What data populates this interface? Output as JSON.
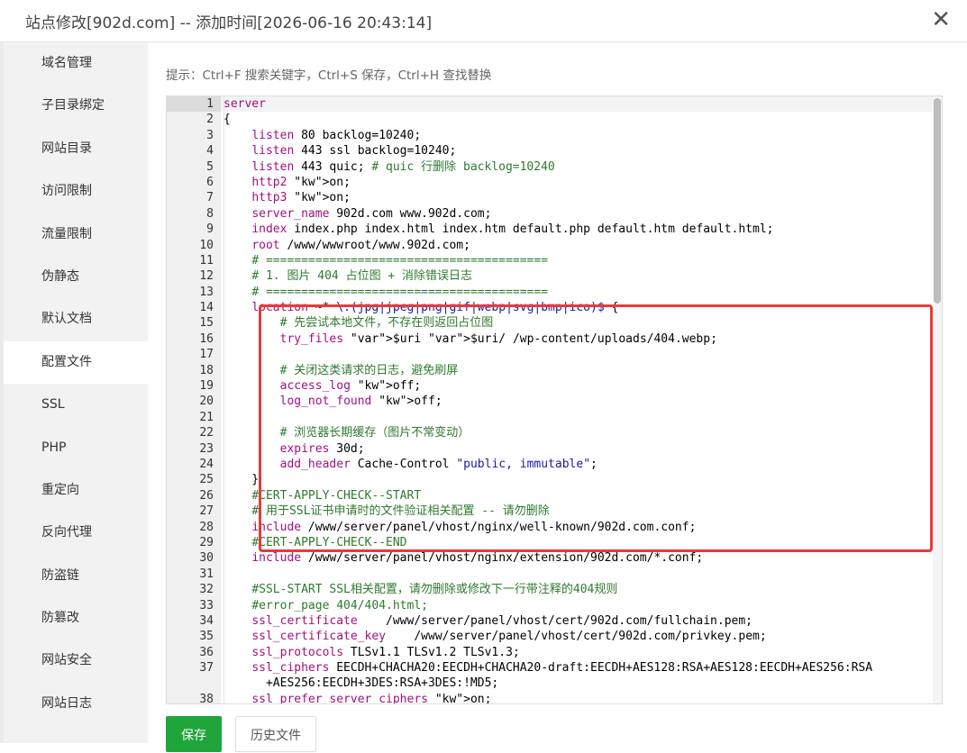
{
  "dialog": {
    "title": "站点修改[902d.com] -- 添加时间[2026-06-16 20:43:14]",
    "close_icon": "close-icon"
  },
  "sidebar": {
    "items": [
      {
        "label": "域名管理"
      },
      {
        "label": "子目录绑定"
      },
      {
        "label": "网站目录"
      },
      {
        "label": "访问限制"
      },
      {
        "label": "流量限制"
      },
      {
        "label": "伪静态"
      },
      {
        "label": "默认文档"
      },
      {
        "label": "配置文件",
        "active": true
      },
      {
        "label": "SSL"
      },
      {
        "label": "PHP"
      },
      {
        "label": "重定向"
      },
      {
        "label": "反向代理"
      },
      {
        "label": "防盗链"
      },
      {
        "label": "防篡改"
      },
      {
        "label": "网站安全"
      },
      {
        "label": "网站日志"
      }
    ]
  },
  "main": {
    "tip": "提示：Ctrl+F 搜索关键字，Ctrl+S 保存，Ctrl+H 查找替换",
    "editor": {
      "active_line": 1,
      "lines": [
        {
          "n": "1",
          "text": "server"
        },
        {
          "n": "2",
          "text": "{"
        },
        {
          "n": "3",
          "text": "    listen 80 backlog=10240;"
        },
        {
          "n": "4",
          "text": "    listen 443 ssl backlog=10240;"
        },
        {
          "n": "5",
          "text": "    listen 443 quic; # quic 行删除 backlog=10240"
        },
        {
          "n": "6",
          "text": "    http2 on;"
        },
        {
          "n": "7",
          "text": "    http3 on;"
        },
        {
          "n": "8",
          "text": "    server_name 902d.com www.902d.com;"
        },
        {
          "n": "9",
          "text": "    index index.php index.html index.htm default.php default.htm default.html;"
        },
        {
          "n": "10",
          "text": "    root /www/wwwroot/www.902d.com;"
        },
        {
          "n": "11",
          "text": "    # ========================================"
        },
        {
          "n": "12",
          "text": "    # 1. 图片 404 占位图 + 消除错误日志"
        },
        {
          "n": "13",
          "text": "    # ========================================"
        },
        {
          "n": "14",
          "text": "    location ~* \\.(jpg|jpeg|png|gif|webp|svg|bmp|ico)$ {"
        },
        {
          "n": "15",
          "text": "        # 先尝试本地文件，不存在则返回占位图"
        },
        {
          "n": "16",
          "text": "        try_files $uri $uri/ /wp-content/uploads/404.webp;"
        },
        {
          "n": "17",
          "text": ""
        },
        {
          "n": "18",
          "text": "        # 关闭这类请求的日志，避免刷屏"
        },
        {
          "n": "19",
          "text": "        access_log off;"
        },
        {
          "n": "20",
          "text": "        log_not_found off;"
        },
        {
          "n": "21",
          "text": ""
        },
        {
          "n": "22",
          "text": "        # 浏览器长期缓存（图片不常变动）"
        },
        {
          "n": "23",
          "text": "        expires 30d;"
        },
        {
          "n": "24",
          "text": "        add_header Cache-Control \"public, immutable\";"
        },
        {
          "n": "25",
          "text": "    }"
        },
        {
          "n": "26",
          "text": "    #CERT-APPLY-CHECK--START"
        },
        {
          "n": "27",
          "text": "    # 用于SSL证书申请时的文件验证相关配置 -- 请勿删除"
        },
        {
          "n": "28",
          "text": "    include /www/server/panel/vhost/nginx/well-known/902d.com.conf;"
        },
        {
          "n": "29",
          "text": "    #CERT-APPLY-CHECK--END"
        },
        {
          "n": "30",
          "text": "    include /www/server/panel/vhost/nginx/extension/902d.com/*.conf;"
        },
        {
          "n": "31",
          "text": ""
        },
        {
          "n": "32",
          "text": "    #SSL-START SSL相关配置，请勿删除或修改下一行带注释的404规则"
        },
        {
          "n": "33",
          "text": "    #error_page 404/404.html;"
        },
        {
          "n": "34",
          "text": "    ssl_certificate    /www/server/panel/vhost/cert/902d.com/fullchain.pem;"
        },
        {
          "n": "35",
          "text": "    ssl_certificate_key    /www/server/panel/vhost/cert/902d.com/privkey.pem;"
        },
        {
          "n": "36",
          "text": "    ssl_protocols TLSv1.1 TLSv1.2 TLSv1.3;"
        },
        {
          "n": "37",
          "text": "    ssl_ciphers EECDH+CHACHA20:EECDH+CHACHA20-draft:EECDH+AES128:RSA+AES128:EECDH+AES256:RSA",
          "wrap": "+AES256:EECDH+3DES:RSA+3DES:!MD5;"
        },
        {
          "n": "38",
          "text": "    ssl_prefer_server_ciphers on;"
        }
      ]
    }
  },
  "footer": {
    "save_label": "保存",
    "history_label": "历史文件"
  },
  "colors": {
    "accent": "#20a53a",
    "highlight_border": "#e83a3a"
  }
}
